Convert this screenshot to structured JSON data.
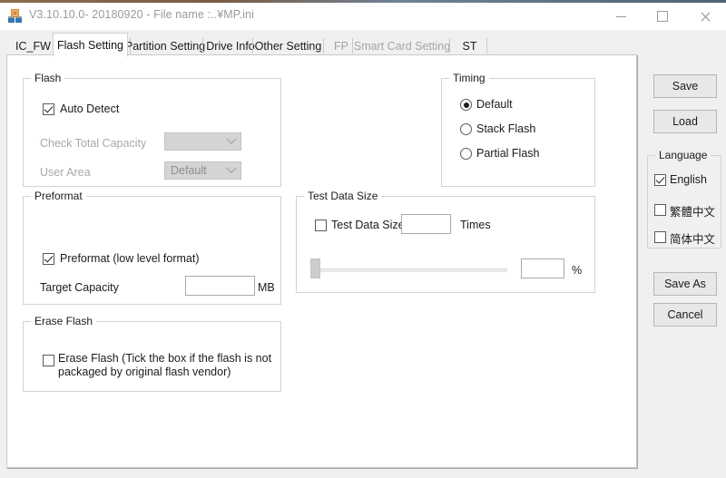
{
  "window": {
    "title": "V3.10.10.0- 20180920 - File name :..¥MP.ini",
    "app_icon": "chip-tool-icon",
    "minimize_label": "—",
    "maximize_label": "□",
    "close_label": "✕"
  },
  "tabs": [
    {
      "label": "IC_FW",
      "selected": false,
      "enabled": true
    },
    {
      "label": "Flash Setting",
      "selected": true,
      "enabled": true
    },
    {
      "label": "Partition Setting",
      "selected": false,
      "enabled": true
    },
    {
      "label": "Drive Info",
      "selected": false,
      "enabled": true
    },
    {
      "label": "Other Setting",
      "selected": false,
      "enabled": true
    },
    {
      "label": "FP",
      "selected": false,
      "enabled": false
    },
    {
      "label": "Smart Card Setting",
      "selected": false,
      "enabled": false
    },
    {
      "label": "ST",
      "selected": false,
      "enabled": true
    }
  ],
  "flash_group": {
    "title": "Flash",
    "auto_detect": {
      "label": "Auto Detect",
      "checked": true
    },
    "check_total_capacity": {
      "label": "Check Total Capacity",
      "value": "",
      "enabled": false
    },
    "user_area": {
      "label": "User Area",
      "value": "Default",
      "enabled": false
    }
  },
  "preformat_group": {
    "title": "Preformat",
    "preformat": {
      "label": "Preformat (low level format)",
      "checked": true
    },
    "target_capacity": {
      "label": "Target Capacity",
      "value": "",
      "unit": "MB"
    }
  },
  "erase_group": {
    "title": "Erase Flash",
    "erase_flash": {
      "label": "Erase Flash (Tick the box if the flash is not packaged by original flash vendor)",
      "checked": false
    }
  },
  "timing_group": {
    "title": "Timing",
    "options": [
      {
        "label": "Default",
        "selected": true
      },
      {
        "label": "Stack Flash",
        "selected": false
      },
      {
        "label": "Partial Flash",
        "selected": false
      }
    ]
  },
  "test_data_group": {
    "title": "Test Data Size",
    "test_data_size": {
      "label": "Test Data Size",
      "checked": false,
      "value": "",
      "unit": "Times"
    },
    "slider": {
      "value": "",
      "unit": "%",
      "percent": 0
    }
  },
  "side_panel": {
    "save": "Save",
    "load": "Load",
    "save_as": "Save As",
    "cancel": "Cancel",
    "language_group": {
      "title": "Language",
      "options": [
        {
          "label": "English",
          "checked": true
        },
        {
          "label": "繁體中文",
          "checked": false
        },
        {
          "label": "简体中文",
          "checked": false
        }
      ]
    }
  },
  "colors": {
    "window_bg": "#f0f0f0",
    "panel_bg": "#ffffff",
    "border": "#d2d2d2",
    "disabled_text": "#a8a8a8",
    "button_bg": "#e8e8e8"
  }
}
